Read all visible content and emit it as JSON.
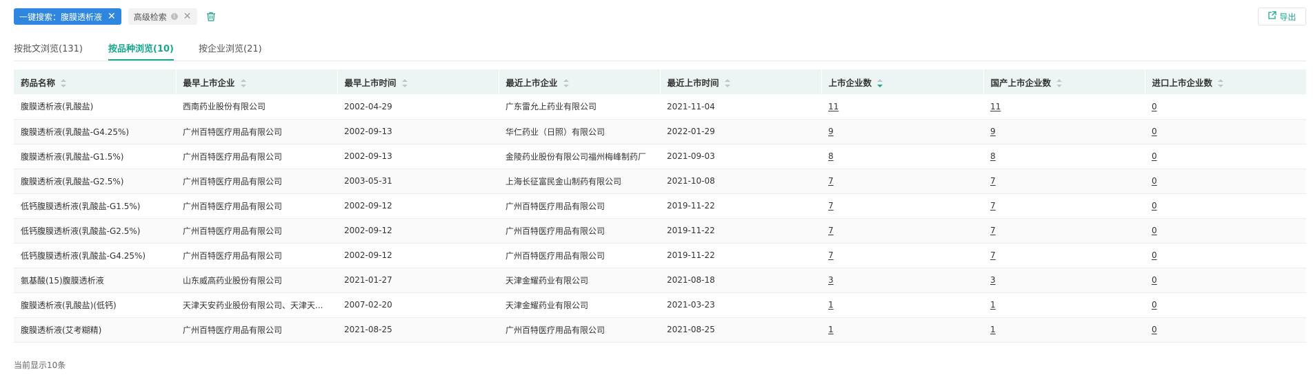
{
  "search": {
    "chip_label": "一键搜索：腹膜透析液",
    "advanced_label": "高级检索"
  },
  "toolbar": {
    "export_label": "导出"
  },
  "tabs": [
    {
      "label": "按批文浏览(131)"
    },
    {
      "label": "按品种浏览(10)"
    },
    {
      "label": "按企业浏览(21)"
    }
  ],
  "table": {
    "headers": [
      "药品名称",
      "最早上市企业",
      "最早上市时间",
      "最近上市企业",
      "最近上市时间",
      "上市企业数",
      "国产上市企业数",
      "进口上市企业数"
    ],
    "rows": [
      [
        "腹膜透析液(乳酸盐)",
        "西南药业股份有限公司",
        "2002-04-29",
        "广东雷允上药业有限公司",
        "2021-11-04",
        "11",
        "11",
        "0"
      ],
      [
        "腹膜透析液(乳酸盐-G4.25%)",
        "广州百特医疗用品有限公司",
        "2002-09-13",
        "华仁药业（日照）有限公司",
        "2022-01-29",
        "9",
        "9",
        "0"
      ],
      [
        "腹膜透析液(乳酸盐-G1.5%)",
        "广州百特医疗用品有限公司",
        "2002-09-13",
        "金陵药业股份有限公司福州梅峰制药厂",
        "2021-09-03",
        "8",
        "8",
        "0"
      ],
      [
        "腹膜透析液(乳酸盐-G2.5%)",
        "广州百特医疗用品有限公司",
        "2003-05-31",
        "上海长征富民金山制药有限公司",
        "2021-10-08",
        "7",
        "7",
        "0"
      ],
      [
        "低钙腹膜透析液(乳酸盐-G1.5%)",
        "广州百特医疗用品有限公司",
        "2002-09-12",
        "广州百特医疗用品有限公司",
        "2019-11-22",
        "7",
        "7",
        "0"
      ],
      [
        "低钙腹膜透析液(乳酸盐-G2.5%)",
        "广州百特医疗用品有限公司",
        "2002-09-12",
        "广州百特医疗用品有限公司",
        "2019-11-22",
        "7",
        "7",
        "0"
      ],
      [
        "低钙腹膜透析液(乳酸盐-G4.25%)",
        "广州百特医疗用品有限公司",
        "2002-09-12",
        "广州百特医疗用品有限公司",
        "2019-11-22",
        "7",
        "7",
        "0"
      ],
      [
        "氨基酸(15)腹膜透析液",
        "山东威高药业股份有限公司",
        "2021-01-27",
        "天津金耀药业有限公司",
        "2021-08-18",
        "3",
        "3",
        "0"
      ],
      [
        "腹膜透析液(乳酸盐)(低钙)",
        "天津天安药业股份有限公司、天津天...",
        "2007-02-20",
        "天津金耀药业有限公司",
        "2021-03-23",
        "1",
        "1",
        "0"
      ],
      [
        "腹膜透析液(艾考糊精)",
        "广州百特医疗用品有限公司",
        "2021-08-25",
        "广州百特医疗用品有限公司",
        "2021-08-25",
        "1",
        "1",
        "0"
      ]
    ]
  },
  "footer": {
    "count_label": "当前显示10条"
  },
  "colors": {
    "primary": "#2e86de",
    "accent": "#18a88c",
    "header_bg": "#edf5f4"
  },
  "icons": [
    "close-icon",
    "info-icon",
    "trash-icon",
    "export-icon",
    "sort-icon"
  ]
}
